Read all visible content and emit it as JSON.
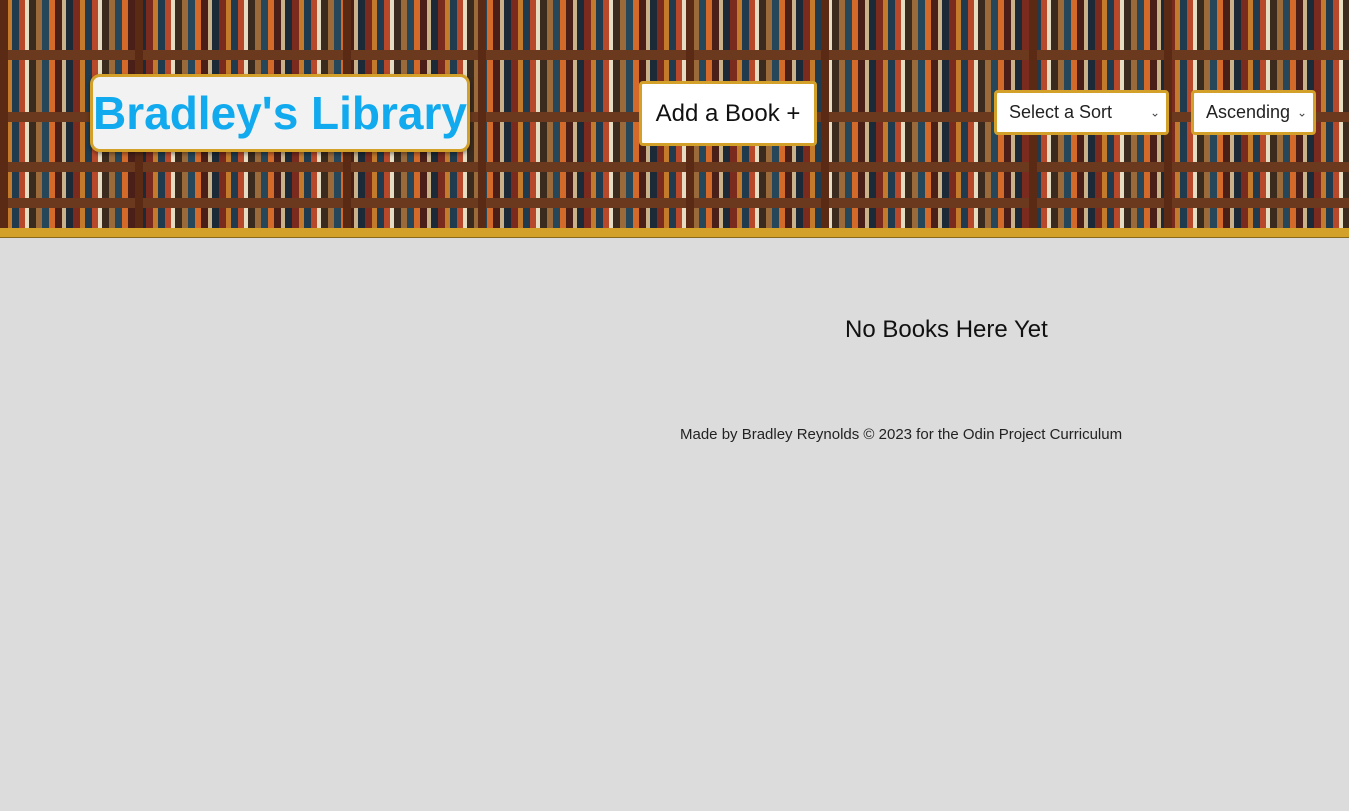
{
  "header": {
    "title": "Bradley's Library",
    "add_button_label": "Add a Book +",
    "sort_select": {
      "selected": "Select a Sort",
      "icon": "chevron-down-icon"
    },
    "order_select": {
      "selected": "Ascending",
      "icon": "chevron-down-icon"
    },
    "colors": {
      "title": "#11aaee",
      "accent_border": "#d3a12a"
    }
  },
  "main": {
    "empty_message": "No Books Here Yet"
  },
  "footer": {
    "credit": "Made by Bradley Reynolds © 2023 for the Odin Project Curriculum"
  }
}
